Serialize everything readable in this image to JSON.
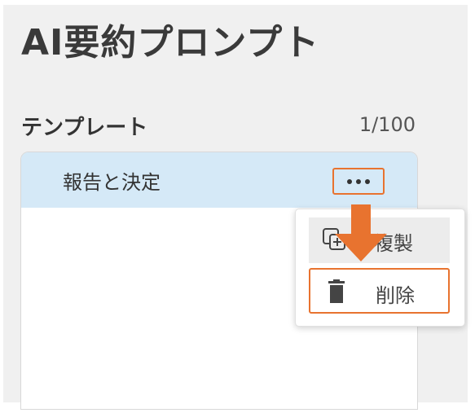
{
  "app": {
    "title": "AI要約プロンプト"
  },
  "templates": {
    "label": "テンプレート",
    "count": "1/100",
    "items": [
      {
        "label": "報告と決定"
      }
    ]
  },
  "context_menu": {
    "items": [
      {
        "label": "複製",
        "icon": "duplicate-icon"
      },
      {
        "label": "削除",
        "icon": "trash-icon"
      }
    ]
  },
  "colors": {
    "highlight": "#e8732f",
    "selected_row": "#d5e9f7",
    "panel_bg": "#f0f0f0"
  }
}
